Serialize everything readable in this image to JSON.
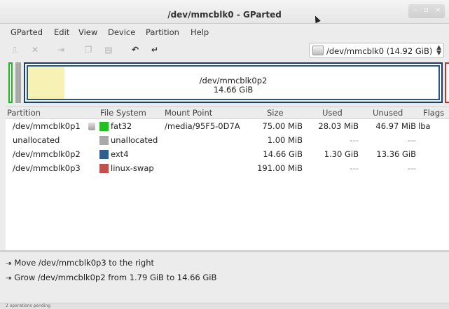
{
  "window": {
    "title": "/dev/mmcblk0 - GParted"
  },
  "menubar": {
    "items": [
      "GParted",
      "Edit",
      "View",
      "Device",
      "Partition",
      "Help"
    ]
  },
  "toolbar": {
    "icons": [
      "new-icon",
      "delete-icon",
      "resize-icon",
      "copy-icon",
      "paste-icon",
      "undo-icon",
      "apply-icon"
    ],
    "device_select": "/dev/mmcblk0  (14.92 GiB)"
  },
  "disk_map": {
    "selected_name": "/dev/mmcblk0p2",
    "selected_size": "14.66 GiB",
    "used_fraction": 0.089
  },
  "table": {
    "headers": [
      "Partition",
      "File System",
      "Mount Point",
      "Size",
      "Used",
      "Unused",
      "Flags"
    ],
    "rows": [
      {
        "partition": "/dev/mmcblk0p1",
        "fs": "fat32",
        "fs_color": "#22c022",
        "mount": "/media/95F5-0D7A",
        "size": "75.00 MiB",
        "used": "28.03 MiB",
        "unused": "46.97 MiB",
        "flags": "lba"
      },
      {
        "partition": "unallocated",
        "fs": "unallocated",
        "fs_color": "#a9a9a9",
        "mount": "",
        "size": "1.00 MiB",
        "used": "---",
        "unused": "---",
        "flags": ""
      },
      {
        "partition": "/dev/mmcblk0p2",
        "fs": "ext4",
        "fs_color": "#2f5f8f",
        "mount": "",
        "size": "14.66 GiB",
        "used": "1.30 GiB",
        "unused": "13.36 GiB",
        "flags": ""
      },
      {
        "partition": "/dev/mmcblk0p3",
        "fs": "linux-swap",
        "fs_color": "#c0504d",
        "mount": "",
        "size": "191.00 MiB",
        "used": "---",
        "unused": "---",
        "flags": ""
      }
    ]
  },
  "operations": [
    "Move /dev/mmcblk0p3 to the right",
    "Grow /dev/mmcblk0p2 from 1.79 GiB to 14.66 GiB"
  ],
  "status": "2 operations pending"
}
